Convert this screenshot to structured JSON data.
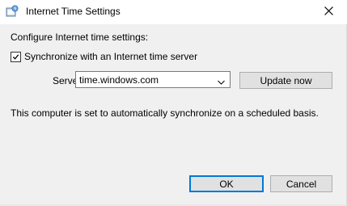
{
  "window": {
    "title": "Internet Time Settings",
    "icon": "internet-time-icon",
    "close_icon": "close-icon"
  },
  "section_label": "Configure Internet time settings:",
  "sync_checkbox": {
    "label": "Synchronize with an Internet time server",
    "checked": true
  },
  "server": {
    "label": "Server:",
    "value": "time.windows.com"
  },
  "buttons": {
    "update": "Update now",
    "ok": "OK",
    "cancel": "Cancel"
  },
  "status_text": "This computer is set to automatically synchronize on a scheduled basis.",
  "colors": {
    "background": "#f0f0f0",
    "titlebar": "#ffffff",
    "default_button_border": "#0078d7"
  }
}
